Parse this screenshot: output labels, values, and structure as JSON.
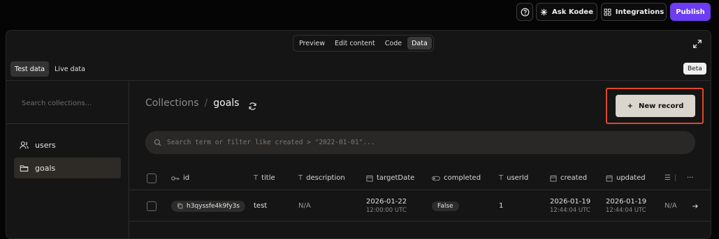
{
  "topbar": {
    "ask_label": "Ask Kodee",
    "integrations_label": "Integrations",
    "publish_label": "Publish"
  },
  "view_tabs": [
    {
      "label": "Preview",
      "active": false
    },
    {
      "label": "Edit content",
      "active": false
    },
    {
      "label": "Code",
      "active": false
    },
    {
      "label": "Data",
      "active": true
    }
  ],
  "data_tabs": [
    {
      "label": "Test data",
      "active": true
    },
    {
      "label": "Live data",
      "active": false
    }
  ],
  "beta_label": "Beta",
  "sidebar": {
    "search_placeholder": "Search collections...",
    "items": [
      {
        "label": "users",
        "icon": "users-icon",
        "active": false
      },
      {
        "label": "goals",
        "icon": "folder-icon",
        "active": true
      }
    ]
  },
  "breadcrumb": {
    "root": "Collections",
    "separator": "/",
    "current": "goals"
  },
  "new_record_label": "New record",
  "search_placeholder": "Search term or filter like created > \"2022-01-01\"...",
  "table": {
    "columns": [
      {
        "label": "id",
        "icon": "key-icon"
      },
      {
        "label": "title",
        "icon": "text-icon"
      },
      {
        "label": "description",
        "icon": "text-icon"
      },
      {
        "label": "targetDate",
        "icon": "calendar-icon"
      },
      {
        "label": "completed",
        "icon": "toggle-icon"
      },
      {
        "label": "userId",
        "icon": "text-icon"
      },
      {
        "label": "created",
        "icon": "calendar-icon"
      },
      {
        "label": "updated",
        "icon": "calendar-icon"
      }
    ],
    "rows": [
      {
        "id": "h3qyssfe4k9fy3s",
        "title": "test",
        "description": "N/A",
        "targetDate": "2026-01-22",
        "targetTime": "12:00:00 UTC",
        "completed": "False",
        "userId": "1",
        "created": "2026-01-19",
        "createdTime": "12:44:04 UTC",
        "updated": "2026-01-19",
        "updatedTime": "12:44:04 UTC",
        "extra": "N/A"
      }
    ]
  },
  "colors": {
    "accent": "#6c3df2",
    "highlight_border": "#e0472e",
    "button_bg": "#dad6ce"
  }
}
